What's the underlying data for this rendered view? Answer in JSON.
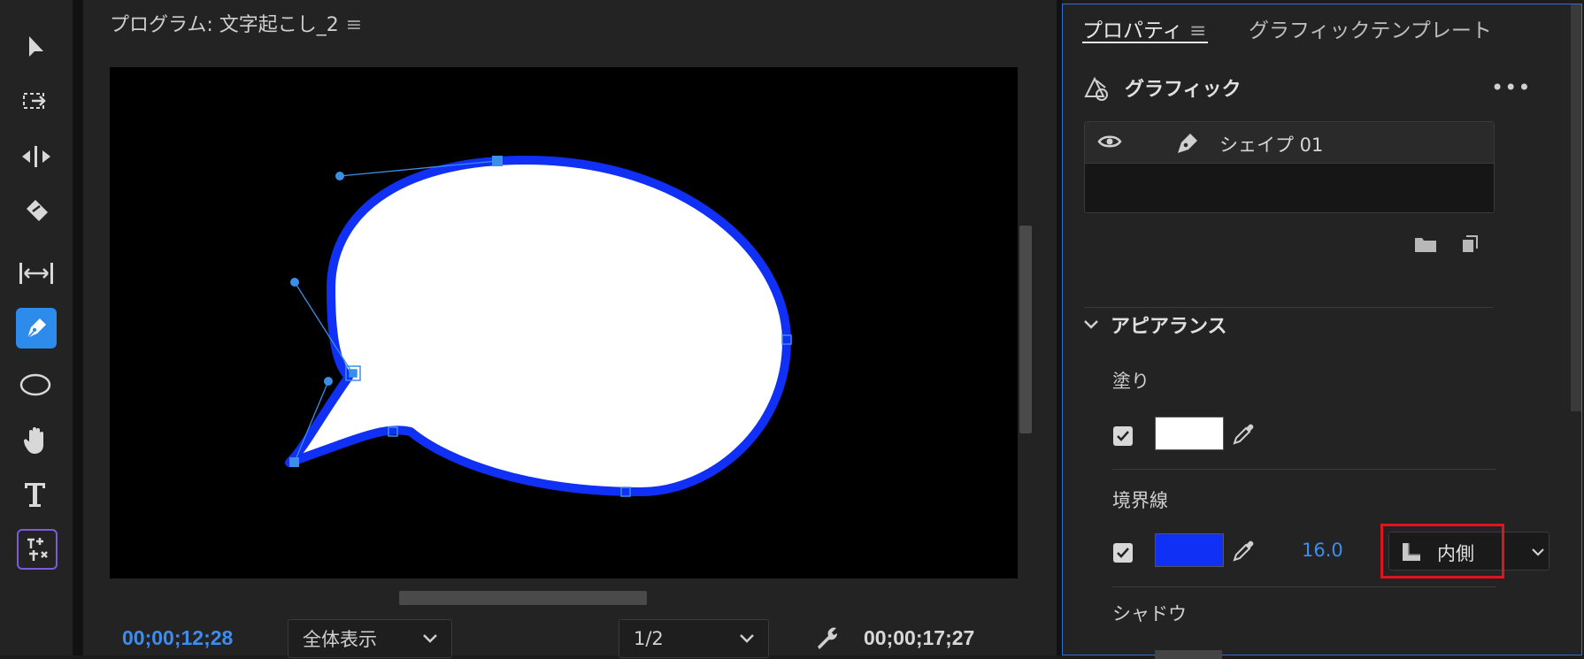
{
  "monitor": {
    "title": "プログラム: 文字起こし_2",
    "menu_glyph": "≡",
    "timecode_current": "00;00;12;28",
    "timecode_duration": "00;00;17;27",
    "zoom_select": "全体表示",
    "resolution_select": "1/2"
  },
  "panel": {
    "tab_properties": "プロパティ",
    "tab_menu_glyph": "≡",
    "tab_templates": "グラフィックテンプレート",
    "graphic_title": "グラフィック",
    "more_glyph": "•••",
    "layer_name": "シェイプ 01",
    "appearance_title": "アピアランス",
    "fill_label": "塗り",
    "fill_color": "#ffffff",
    "stroke_label": "境界線",
    "stroke_color": "#1030f5",
    "stroke_width": "16.0",
    "stroke_position": "内側",
    "shadow_label": "シャドウ"
  },
  "colors": {
    "accent_blue": "#3d8df0",
    "highlight_red": "#e0141e",
    "shape_stroke": "#1030f5"
  },
  "icons": [
    "selection-tool-icon",
    "track-select-icon",
    "ripple-edit-icon",
    "razor-icon",
    "slip-icon",
    "pen-icon",
    "ellipse-icon",
    "hand-icon",
    "type-icon",
    "ai-tool-icon",
    "eye-icon",
    "pen-layer-icon",
    "folder-icon",
    "new-layer-icon",
    "chevron-down-icon",
    "eyedropper-icon",
    "wrench-icon"
  ]
}
